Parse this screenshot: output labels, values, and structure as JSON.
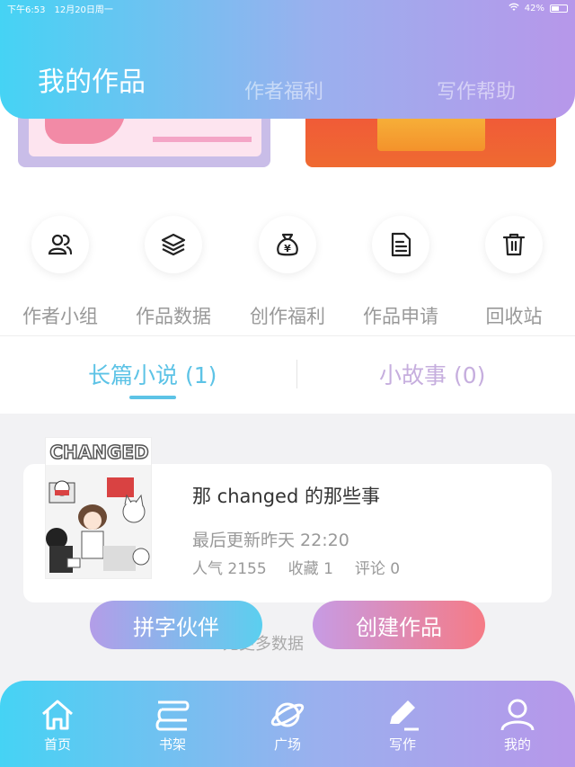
{
  "status_bar": {
    "time": "下午6:53",
    "date": "12月20日周一",
    "battery": "42%",
    "battery_level": 0.42
  },
  "top_tabs": [
    {
      "label": "我的作品",
      "active": true
    },
    {
      "label": "作者福利",
      "active": false
    },
    {
      "label": "写作帮助",
      "active": false
    }
  ],
  "quick_actions": [
    {
      "label": "作者小组",
      "icon": "people-icon"
    },
    {
      "label": "作品数据",
      "icon": "layers-icon"
    },
    {
      "label": "创作福利",
      "icon": "money-bag-icon"
    },
    {
      "label": "作品申请",
      "icon": "document-icon"
    },
    {
      "label": "回收站",
      "icon": "trash-icon"
    }
  ],
  "work_tabs": [
    {
      "label": "长篇小说 (1)",
      "active": true
    },
    {
      "label": "小故事 (0)",
      "active": false
    }
  ],
  "novel": {
    "cover_text": "CHANGED",
    "title": "那 changed 的那些事",
    "updated": "最后更新昨天 22:20",
    "popularity": "人气 2155",
    "favorites": "收藏 1",
    "comments": "评论 0"
  },
  "empty_text": "无更多数据",
  "buttons": {
    "partner": "拼字伙伴",
    "create": "创建作品"
  },
  "bottom_nav": [
    {
      "label": "首页",
      "icon": "home-icon"
    },
    {
      "label": "书架",
      "icon": "bookshelf-icon"
    },
    {
      "label": "广场",
      "icon": "planet-icon"
    },
    {
      "label": "写作",
      "icon": "pen-icon",
      "active": true
    },
    {
      "label": "我的",
      "icon": "user-icon"
    }
  ],
  "colors": {
    "gradient_start": "#45d3f4",
    "gradient_end": "#b797ea",
    "active_tab": "#5dc3e6",
    "inactive_tab": "#c6aede"
  }
}
